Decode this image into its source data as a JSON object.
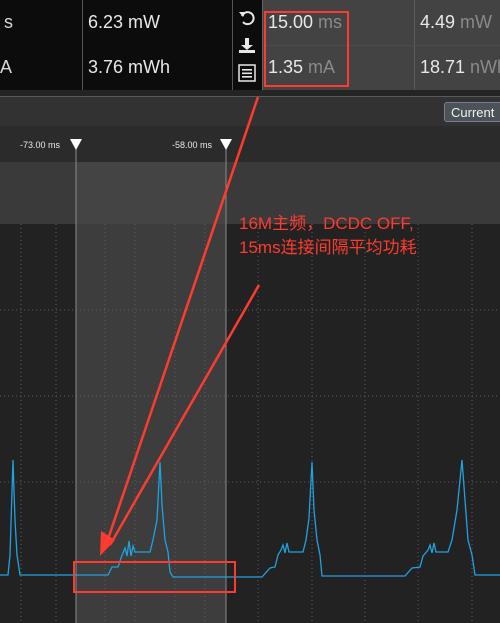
{
  "stats": {
    "row1": {
      "left_label": "s",
      "energy_power": "6.23 mW",
      "interval_value": "15.00",
      "interval_unit": "ms",
      "right_value": "4.49",
      "right_unit": "mW"
    },
    "row2": {
      "left_label": "A",
      "energy": "3.76 mWh",
      "current_value": "1.35",
      "current_unit": "mA",
      "right_value": "18.71",
      "right_unit": "nWh"
    }
  },
  "icons": [
    "undo-icon",
    "download-icon",
    "list-icon"
  ],
  "toolbar": {
    "current_button": "Current"
  },
  "markers": {
    "left_label": "-73.00 ms",
    "right_label": "-58.00 ms"
  },
  "annotation": {
    "line1": "16M主频，DCDC OFF,",
    "line2": "15ms连接间隔平均功耗"
  },
  "colors": {
    "trace": "#1fa3e0",
    "annotation": "#ff3b30",
    "selection": "#4a4a4a"
  }
}
